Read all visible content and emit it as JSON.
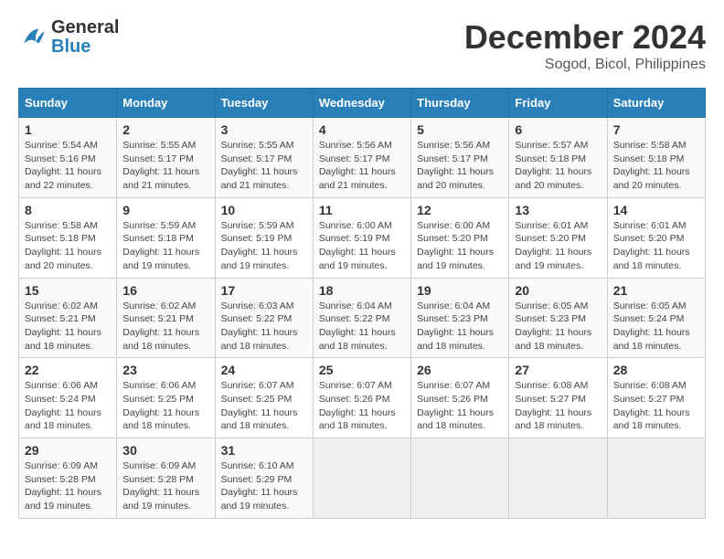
{
  "header": {
    "logo": {
      "general": "General",
      "blue": "Blue"
    },
    "title": "December 2024",
    "location": "Sogod, Bicol, Philippines"
  },
  "calendar": {
    "days_of_week": [
      "Sunday",
      "Monday",
      "Tuesday",
      "Wednesday",
      "Thursday",
      "Friday",
      "Saturday"
    ],
    "weeks": [
      [
        null,
        {
          "day": "2",
          "sunrise": "5:55 AM",
          "sunset": "5:17 PM",
          "daylight": "11 hours and 21 minutes."
        },
        {
          "day": "3",
          "sunrise": "5:55 AM",
          "sunset": "5:17 PM",
          "daylight": "11 hours and 21 minutes."
        },
        {
          "day": "4",
          "sunrise": "5:56 AM",
          "sunset": "5:17 PM",
          "daylight": "11 hours and 21 minutes."
        },
        {
          "day": "5",
          "sunrise": "5:56 AM",
          "sunset": "5:17 PM",
          "daylight": "11 hours and 20 minutes."
        },
        {
          "day": "6",
          "sunrise": "5:57 AM",
          "sunset": "5:18 PM",
          "daylight": "11 hours and 20 minutes."
        },
        {
          "day": "7",
          "sunrise": "5:58 AM",
          "sunset": "5:18 PM",
          "daylight": "11 hours and 20 minutes."
        }
      ],
      [
        {
          "day": "1",
          "sunrise": "5:54 AM",
          "sunset": "5:16 PM",
          "daylight": "11 hours and 22 minutes."
        },
        {
          "day": "9",
          "sunrise": "5:59 AM",
          "sunset": "5:18 PM",
          "daylight": "11 hours and 19 minutes."
        },
        {
          "day": "10",
          "sunrise": "5:59 AM",
          "sunset": "5:19 PM",
          "daylight": "11 hours and 19 minutes."
        },
        {
          "day": "11",
          "sunrise": "6:00 AM",
          "sunset": "5:19 PM",
          "daylight": "11 hours and 19 minutes."
        },
        {
          "day": "12",
          "sunrise": "6:00 AM",
          "sunset": "5:20 PM",
          "daylight": "11 hours and 19 minutes."
        },
        {
          "day": "13",
          "sunrise": "6:01 AM",
          "sunset": "5:20 PM",
          "daylight": "11 hours and 19 minutes."
        },
        {
          "day": "14",
          "sunrise": "6:01 AM",
          "sunset": "5:20 PM",
          "daylight": "11 hours and 18 minutes."
        }
      ],
      [
        {
          "day": "8",
          "sunrise": "5:58 AM",
          "sunset": "5:18 PM",
          "daylight": "11 hours and 20 minutes."
        },
        {
          "day": "16",
          "sunrise": "6:02 AM",
          "sunset": "5:21 PM",
          "daylight": "11 hours and 18 minutes."
        },
        {
          "day": "17",
          "sunrise": "6:03 AM",
          "sunset": "5:22 PM",
          "daylight": "11 hours and 18 minutes."
        },
        {
          "day": "18",
          "sunrise": "6:04 AM",
          "sunset": "5:22 PM",
          "daylight": "11 hours and 18 minutes."
        },
        {
          "day": "19",
          "sunrise": "6:04 AM",
          "sunset": "5:23 PM",
          "daylight": "11 hours and 18 minutes."
        },
        {
          "day": "20",
          "sunrise": "6:05 AM",
          "sunset": "5:23 PM",
          "daylight": "11 hours and 18 minutes."
        },
        {
          "day": "21",
          "sunrise": "6:05 AM",
          "sunset": "5:24 PM",
          "daylight": "11 hours and 18 minutes."
        }
      ],
      [
        {
          "day": "15",
          "sunrise": "6:02 AM",
          "sunset": "5:21 PM",
          "daylight": "11 hours and 18 minutes."
        },
        {
          "day": "23",
          "sunrise": "6:06 AM",
          "sunset": "5:25 PM",
          "daylight": "11 hours and 18 minutes."
        },
        {
          "day": "24",
          "sunrise": "6:07 AM",
          "sunset": "5:25 PM",
          "daylight": "11 hours and 18 minutes."
        },
        {
          "day": "25",
          "sunrise": "6:07 AM",
          "sunset": "5:26 PM",
          "daylight": "11 hours and 18 minutes."
        },
        {
          "day": "26",
          "sunrise": "6:07 AM",
          "sunset": "5:26 PM",
          "daylight": "11 hours and 18 minutes."
        },
        {
          "day": "27",
          "sunrise": "6:08 AM",
          "sunset": "5:27 PM",
          "daylight": "11 hours and 18 minutes."
        },
        {
          "day": "28",
          "sunrise": "6:08 AM",
          "sunset": "5:27 PM",
          "daylight": "11 hours and 18 minutes."
        }
      ],
      [
        {
          "day": "22",
          "sunrise": "6:06 AM",
          "sunset": "5:24 PM",
          "daylight": "11 hours and 18 minutes."
        },
        {
          "day": "30",
          "sunrise": "6:09 AM",
          "sunset": "5:28 PM",
          "daylight": "11 hours and 19 minutes."
        },
        {
          "day": "31",
          "sunrise": "6:10 AM",
          "sunset": "5:29 PM",
          "daylight": "11 hours and 19 minutes."
        },
        null,
        null,
        null,
        null
      ],
      [
        {
          "day": "29",
          "sunrise": "6:09 AM",
          "sunset": "5:28 PM",
          "daylight": "11 hours and 19 minutes."
        },
        null,
        null,
        null,
        null,
        null,
        null
      ]
    ]
  }
}
